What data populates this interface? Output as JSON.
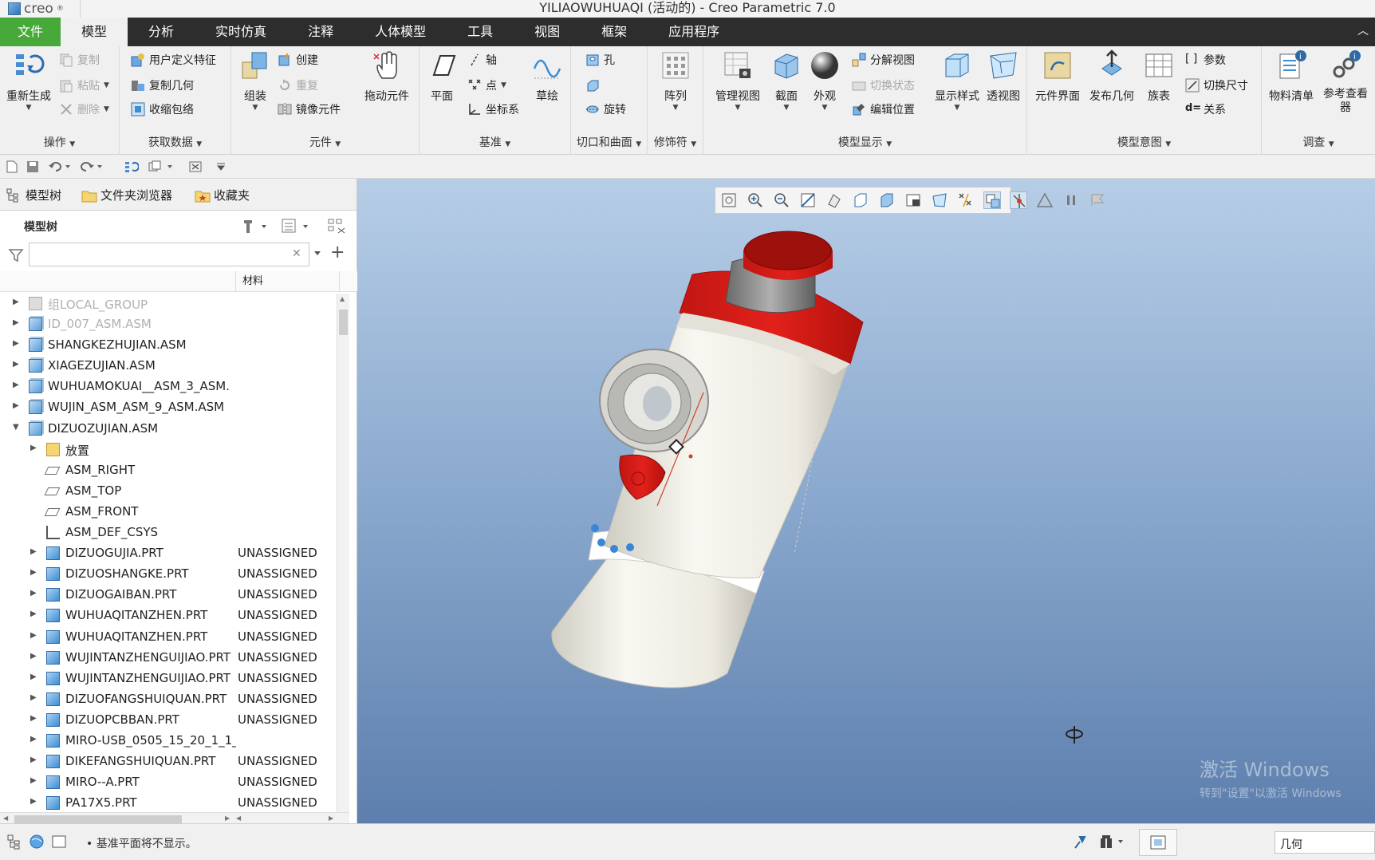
{
  "titlebar": {
    "logo_text": "creo",
    "title": "YILIAOWUHUAQI (活动的) - Creo Parametric 7.0"
  },
  "menubar": {
    "items": [
      "文件",
      "模型",
      "分析",
      "实时仿真",
      "注释",
      "人体模型",
      "工具",
      "视图",
      "框架",
      "应用程序"
    ],
    "active_index": 1
  },
  "ribbon": {
    "groups": {
      "operations": {
        "label": "操作",
        "regenerate": "重新生成",
        "copy": "复制",
        "paste": "粘贴",
        "delete": "删除"
      },
      "get_data": {
        "label": "获取数据",
        "user_feature": "用户定义特征",
        "copy_geom": "复制几何",
        "shrinkwrap": "收缩包络"
      },
      "component": {
        "label": "元件",
        "assemble": "组装",
        "create": "创建",
        "repeat": "重复",
        "mirror": "镜像元件",
        "drag": "拖动元件"
      },
      "datum": {
        "label": "基准",
        "plane": "平面",
        "axis": "轴",
        "point": "点",
        "csys": "坐标系",
        "sketch": "草绘"
      },
      "cut_surface": {
        "label": "切口和曲面",
        "hole": "孔",
        "revolve": "旋转"
      },
      "modifiers": {
        "label": "修饰符",
        "pattern": "阵列"
      },
      "model_display": {
        "label": "模型显示",
        "manage_views": "管理视图",
        "section": "截面",
        "appearance": "外观",
        "exploded": "分解视图",
        "toggle_state": "切换状态",
        "edit_position": "编辑位置",
        "display_style": "显示样式",
        "perspective": "透视图"
      },
      "model_intent": {
        "label": "模型意图",
        "component_interface": "元件界面",
        "publish_geom": "发布几何",
        "family_table": "族表",
        "params": "参数",
        "switch_dims": "切换尺寸",
        "relations": "关系"
      },
      "investigate": {
        "label": "调查",
        "bom": "物料清单",
        "reference_viewer": "参考查看器"
      }
    }
  },
  "left_panel": {
    "tabs": [
      "模型树",
      "文件夹浏览器",
      "收藏夹"
    ],
    "tree_title": "模型树",
    "search_placeholder": "",
    "column_material": "材料",
    "rows": [
      {
        "name": "组LOCAL_GROUP",
        "material": "",
        "level": 0,
        "icon": "group-icon",
        "dim": true,
        "expander": "▶"
      },
      {
        "name": "ID_007_ASM.ASM",
        "material": "",
        "level": 0,
        "icon": "assembly-icon",
        "dim": true,
        "expander": "▶"
      },
      {
        "name": "SHANGKEZHUJIAN.ASM",
        "material": "",
        "level": 0,
        "icon": "assembly-icon",
        "dim": false,
        "expander": "▶"
      },
      {
        "name": "XIAGEZUJIAN.ASM",
        "material": "",
        "level": 0,
        "icon": "assembly-icon",
        "dim": false,
        "expander": "▶"
      },
      {
        "name": "WUHUAMOKUAI__ASM_3_ASM.",
        "material": "",
        "level": 0,
        "icon": "assembly-icon",
        "dim": false,
        "expander": "▶"
      },
      {
        "name": "WUJIN_ASM_ASM_9_ASM.ASM",
        "material": "",
        "level": 0,
        "icon": "assembly-icon",
        "dim": false,
        "expander": "▶"
      },
      {
        "name": "DIZUOZUJIAN.ASM",
        "material": "",
        "level": 0,
        "icon": "assembly-icon",
        "dim": false,
        "expander": "▼"
      },
      {
        "name": "放置",
        "material": "",
        "level": 1,
        "icon": "folder-icon",
        "dim": false,
        "expander": "▶"
      },
      {
        "name": "ASM_RIGHT",
        "material": "",
        "level": 1,
        "icon": "plane-icon",
        "dim": false,
        "expander": ""
      },
      {
        "name": "ASM_TOP",
        "material": "",
        "level": 1,
        "icon": "plane-icon",
        "dim": false,
        "expander": ""
      },
      {
        "name": "ASM_FRONT",
        "material": "",
        "level": 1,
        "icon": "plane-icon",
        "dim": false,
        "expander": ""
      },
      {
        "name": "ASM_DEF_CSYS",
        "material": "",
        "level": 1,
        "icon": "csys-icon",
        "dim": false,
        "expander": ""
      },
      {
        "name": "DIZUOGUJIA.PRT",
        "material": "UNASSIGNED",
        "level": 1,
        "icon": "part-icon",
        "dim": false,
        "expander": "▶"
      },
      {
        "name": "DIZUOSHANGKE.PRT",
        "material": "UNASSIGNED",
        "level": 1,
        "icon": "part-icon",
        "dim": false,
        "expander": "▶"
      },
      {
        "name": "DIZUOGAIBAN.PRT",
        "material": "UNASSIGNED",
        "level": 1,
        "icon": "part-icon",
        "dim": false,
        "expander": "▶"
      },
      {
        "name": "WUHUAQITANZHEN.PRT",
        "material": "UNASSIGNED",
        "level": 1,
        "icon": "part-icon",
        "dim": false,
        "expander": "▶"
      },
      {
        "name": "WUHUAQITANZHEN.PRT",
        "material": "UNASSIGNED",
        "level": 1,
        "icon": "part-icon",
        "dim": false,
        "expander": "▶"
      },
      {
        "name": "WUJINTANZHENGUIJIAO.PRT",
        "material": "UNASSIGNED",
        "level": 1,
        "icon": "part-icon",
        "dim": false,
        "expander": "▶"
      },
      {
        "name": "WUJINTANZHENGUIJIAO.PRT",
        "material": "UNASSIGNED",
        "level": 1,
        "icon": "part-icon",
        "dim": false,
        "expander": "▶"
      },
      {
        "name": "DIZUOFANGSHUIQUAN.PRT",
        "material": "UNASSIGNED",
        "level": 1,
        "icon": "part-icon",
        "dim": false,
        "expander": "▶"
      },
      {
        "name": "DIZUOPCBBAN.PRT",
        "material": "UNASSIGNED",
        "level": 1,
        "icon": "part-icon",
        "dim": false,
        "expander": "▶"
      },
      {
        "name": "MIRO-USB_0505_15_20_1_1_",
        "material": "",
        "level": 1,
        "icon": "part-icon",
        "dim": false,
        "expander": "▶"
      },
      {
        "name": "DIKEFANGSHUIQUAN.PRT",
        "material": "UNASSIGNED",
        "level": 1,
        "icon": "part-icon",
        "dim": false,
        "expander": "▶"
      },
      {
        "name": "MIRO--A.PRT",
        "material": "UNASSIGNED",
        "level": 1,
        "icon": "part-icon",
        "dim": false,
        "expander": "▶"
      },
      {
        "name": "PA17X5.PRT",
        "material": "UNASSIGNED",
        "level": 1,
        "icon": "part-icon",
        "dim": false,
        "expander": "▶"
      }
    ]
  },
  "viewport": {
    "watermark_line1": "激活 Windows",
    "watermark_line2": "转到\"设置\"以激活 Windows"
  },
  "statusbar": {
    "message": "• 基准平面将不显示。",
    "filter_value": "几何"
  },
  "colors": {
    "file_menu": "#47a93a",
    "menubar": "#2d2d2d",
    "device_red": "#d8201c",
    "device_body": "#efeee6"
  }
}
